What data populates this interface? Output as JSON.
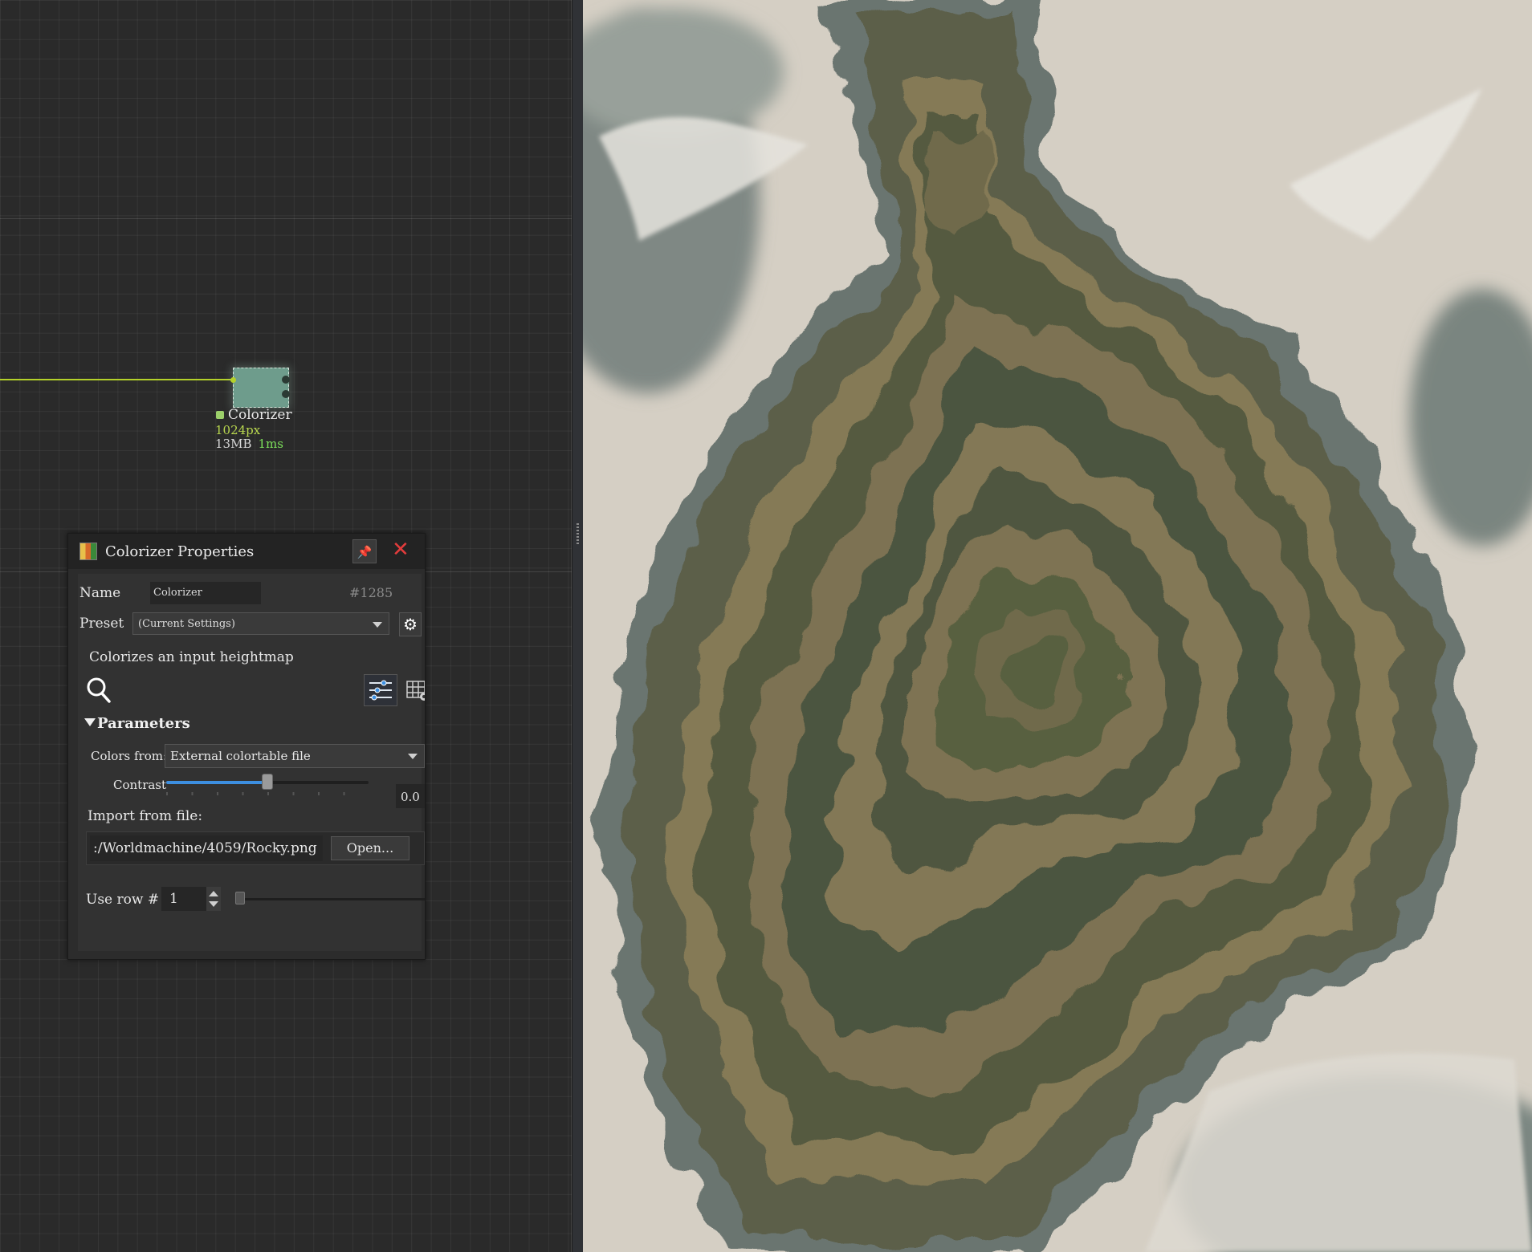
{
  "graph": {
    "node": {
      "title": "Colorizer",
      "resolution": "1024px",
      "memory": "13MB",
      "time": "1ms",
      "colors": {
        "body": "#6e9c8c",
        "wire": "#b4d12a",
        "status": "#9ccf6a"
      }
    }
  },
  "properties": {
    "title": "Colorizer Properties",
    "name_label": "Name",
    "name_value": "Colorizer",
    "node_id": "#1285",
    "preset_label": "Preset",
    "preset_value": "(Current Settings)",
    "description": "Colorizes an input heightmap",
    "parameters_header": "Parameters",
    "colors_from_label": "Colors from:",
    "colors_from_value": "External colortable file",
    "contrast_label": "Contrast",
    "contrast_value": "0.0",
    "contrast_slider_fraction": 0.5,
    "import_label": "Import from file:",
    "file_path": ":/Worldmachine/4059/Rocky.png",
    "open_button": "Open...",
    "use_row_label": "Use row #",
    "use_row_value": "1",
    "icons": [
      "app-icon",
      "pin-icon",
      "close-icon",
      "globe-icon",
      "contrast-icon",
      "gear-icon",
      "search-icon",
      "sliders-icon",
      "grid-gear-icon"
    ]
  },
  "preview": {
    "content": "terrain-colorized-heightmap",
    "colors": {
      "lowland": "#5e5c3a",
      "band_dark": "#49503a",
      "band_light": "#877a57",
      "slope": "#6c7670",
      "snow": "#d9d3c8"
    }
  }
}
